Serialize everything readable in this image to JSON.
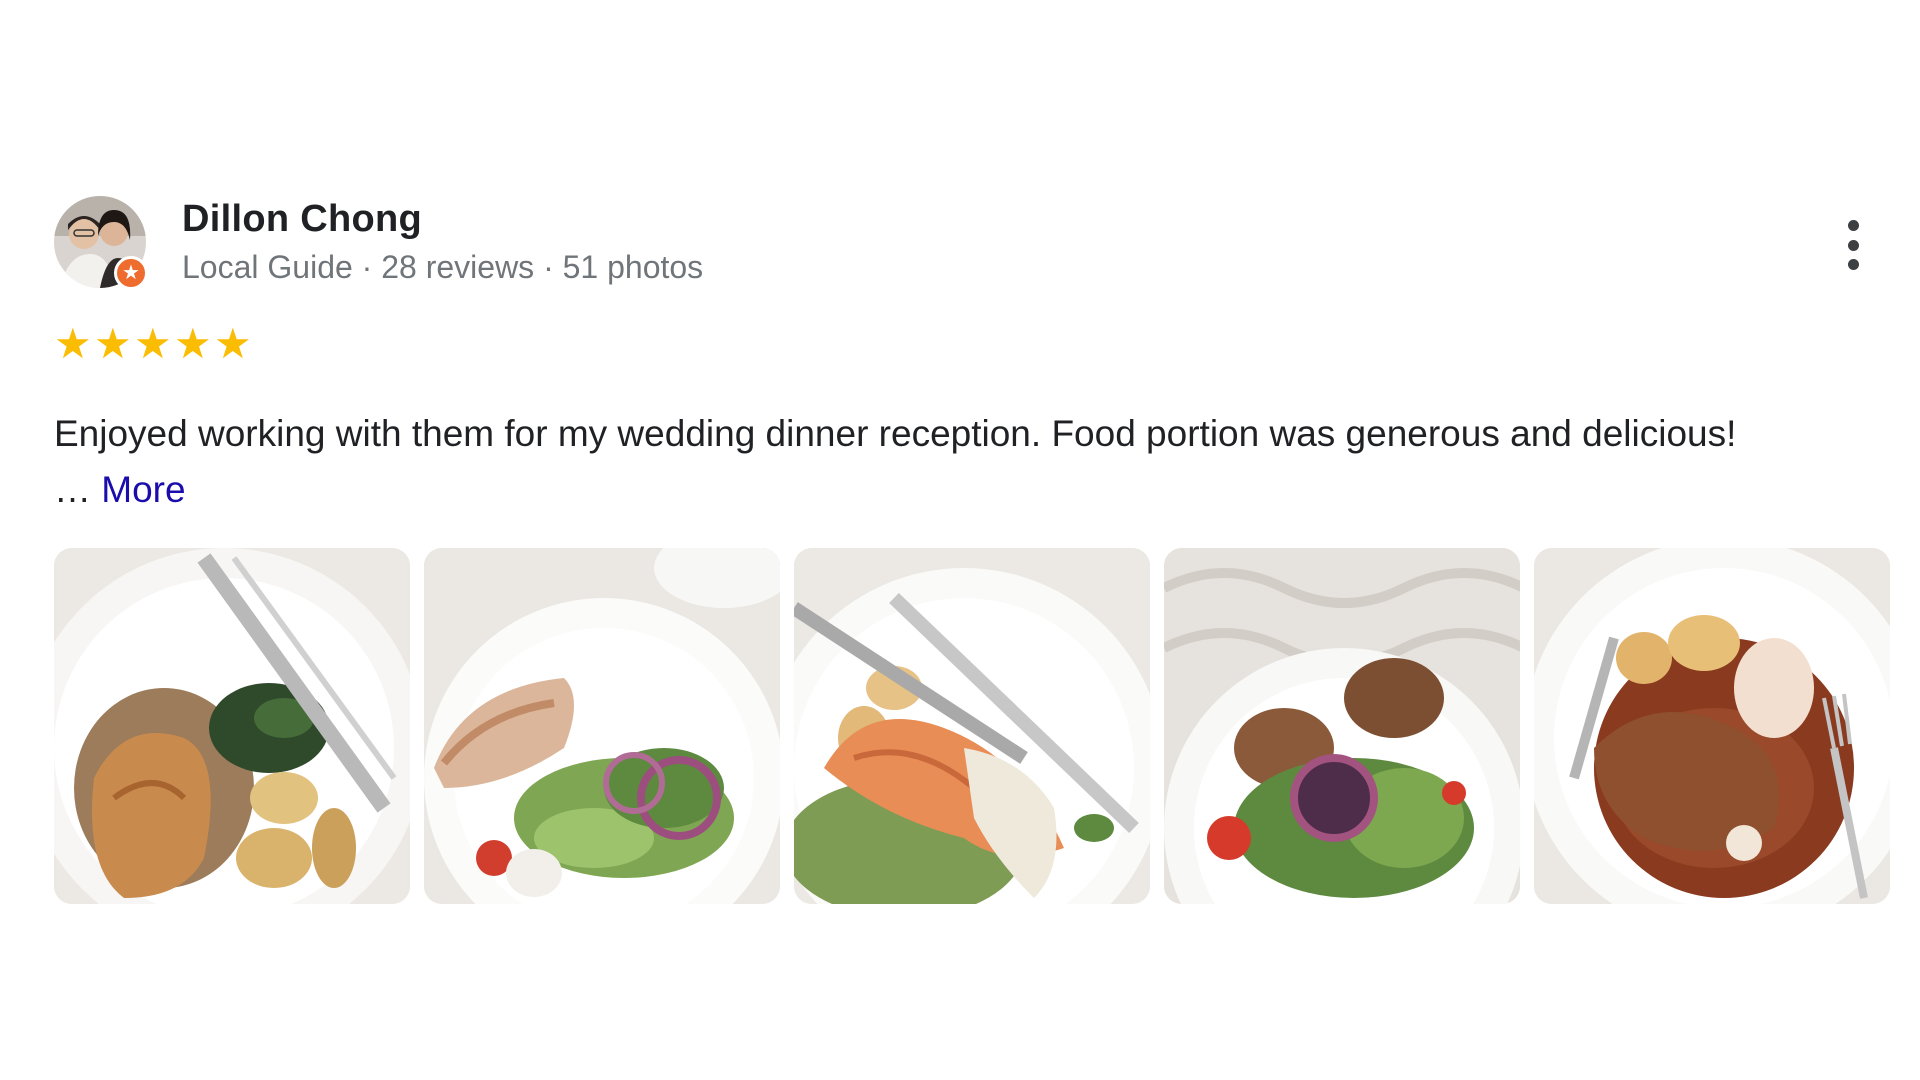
{
  "author": {
    "name": "Dillon Chong",
    "meta": "Local Guide · 28 reviews · 51 photos",
    "badge_icon": "local-guide-star-icon",
    "badge_glyph": "★"
  },
  "menu": {
    "icon": "more-vert-icon"
  },
  "rating": {
    "stars": 5,
    "max": 5,
    "star_glyph": "★",
    "color": "#fbbc04"
  },
  "review": {
    "text": "Enjoyed working with them for my wedding dinner reception. Food portion was generous and delicious!",
    "ellipsis": "… ",
    "more_label": "More"
  },
  "photos": [
    {
      "name": "photo-chicken-with-spinach-and-potatoes"
    },
    {
      "name": "photo-turkey-with-salad"
    },
    {
      "name": "photo-salmon-with-cream-sauce"
    },
    {
      "name": "photo-croquettes-with-salad"
    },
    {
      "name": "photo-braised-lamb-shank"
    }
  ],
  "colors": {
    "text": "#202124",
    "meta": "#70757a",
    "link": "#1a0dab",
    "badge": "#ef6c2f"
  }
}
